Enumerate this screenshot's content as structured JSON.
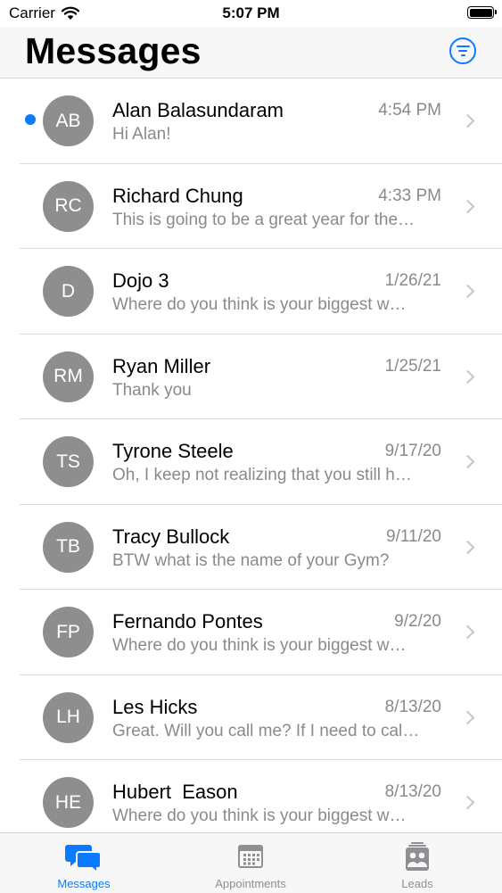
{
  "status_bar": {
    "carrier": "Carrier",
    "time": "5:07 PM"
  },
  "header": {
    "title": "Messages",
    "filter_icon": "filter-circle-icon"
  },
  "conversations": [
    {
      "initials": "AB",
      "name": "Alan Balasundaram",
      "time": "4:54 PM",
      "preview": "Hi Alan!",
      "unread": true
    },
    {
      "initials": "RC",
      "name": "Richard Chung",
      "time": "4:33 PM",
      "preview": "This is going to be a great year for the…",
      "unread": false
    },
    {
      "initials": "D",
      "name": "Dojo 3",
      "time": "1/26/21",
      "preview": "Where do you think is your biggest w…",
      "unread": false
    },
    {
      "initials": "RM",
      "name": "Ryan Miller",
      "time": "1/25/21",
      "preview": "Thank you",
      "unread": false
    },
    {
      "initials": "TS",
      "name": "Tyrone Steele",
      "time": "9/17/20",
      "preview": "Oh, I keep not realizing that you still h…",
      "unread": false
    },
    {
      "initials": "TB",
      "name": "Tracy Bullock",
      "time": "9/11/20",
      "preview": "BTW what is the name of your Gym?",
      "unread": false
    },
    {
      "initials": "FP",
      "name": "Fernando Pontes",
      "time": "9/2/20",
      "preview": "Where do you think is your biggest w…",
      "unread": false
    },
    {
      "initials": "LH",
      "name": "Les Hicks",
      "time": "8/13/20",
      "preview": "Great. Will you call me? If I need to cal…",
      "unread": false
    },
    {
      "initials": "HE",
      "name": "Hubert  Eason",
      "time": "8/13/20",
      "preview": "Where do you think is your biggest w…",
      "unread": false
    }
  ],
  "tabs": [
    {
      "label": "Messages",
      "icon": "chat-bubbles-icon",
      "active": true
    },
    {
      "label": "Appointments",
      "icon": "calendar-icon",
      "active": false
    },
    {
      "label": "Leads",
      "icon": "contacts-icon",
      "active": false
    }
  ],
  "colors": {
    "accent": "#0a7aff",
    "avatar": "#8e8e8e",
    "secondary_text": "#8a8a8e"
  }
}
